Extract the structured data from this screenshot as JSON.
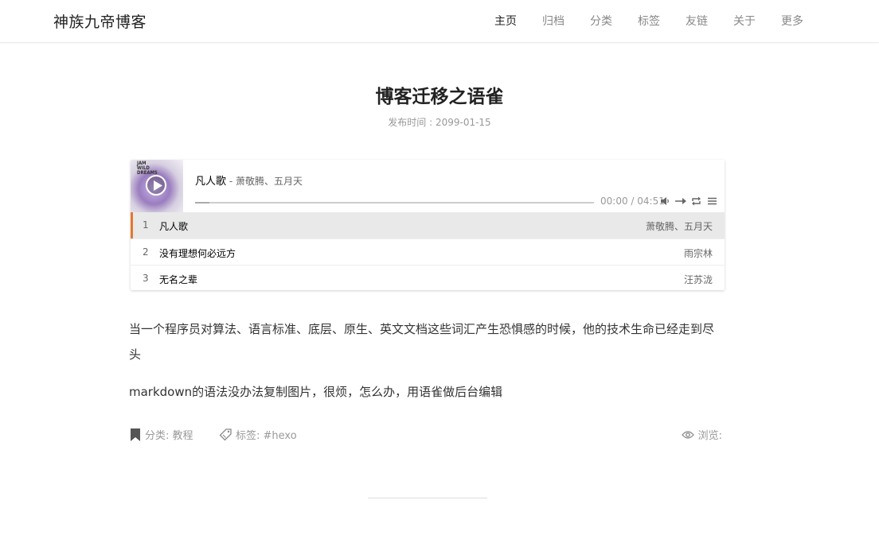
{
  "header": {
    "site_title": "神族九帝博客",
    "nav": [
      {
        "label": "主页",
        "active": true
      },
      {
        "label": "归档",
        "active": false
      },
      {
        "label": "分类",
        "active": false
      },
      {
        "label": "标签",
        "active": false
      },
      {
        "label": "友链",
        "active": false
      },
      {
        "label": "关于",
        "active": false
      },
      {
        "label": "更多",
        "active": false
      }
    ]
  },
  "post": {
    "title": "博客迁移之语雀",
    "meta": "发布时间 : 2099-01-15",
    "paragraphs": [
      "当一个程序员对算法、语言标准、底层、原生、英文文档这些词汇产生恐惧感的时候，他的技术生命已经走到尽头",
      "markdown的语法没办法复制图片，很烦，怎么办，用语雀做后台编辑"
    ],
    "category": "分类: 教程",
    "tags": "标签: #hexo",
    "views": "浏览:"
  },
  "player": {
    "cover_text": "JAM\nWILD\nDREAMS",
    "current_title": "凡人歌",
    "current_artist": " - 萧敬腾、五月天",
    "time": "00:00 / 04:51",
    "progress": 0.035,
    "accent_color": "#e6762f",
    "playlist": [
      {
        "index": "1",
        "title": "凡人歌",
        "artist": "萧敬腾、五月天",
        "active": true
      },
      {
        "index": "2",
        "title": "没有理想何必远方",
        "artist": "雨宗林",
        "active": false
      },
      {
        "index": "3",
        "title": "无名之辈",
        "artist": "汪苏泷",
        "active": false
      }
    ],
    "icons": [
      "play-icon",
      "volume-icon",
      "order-icon",
      "loop-icon",
      "menu-icon"
    ]
  }
}
